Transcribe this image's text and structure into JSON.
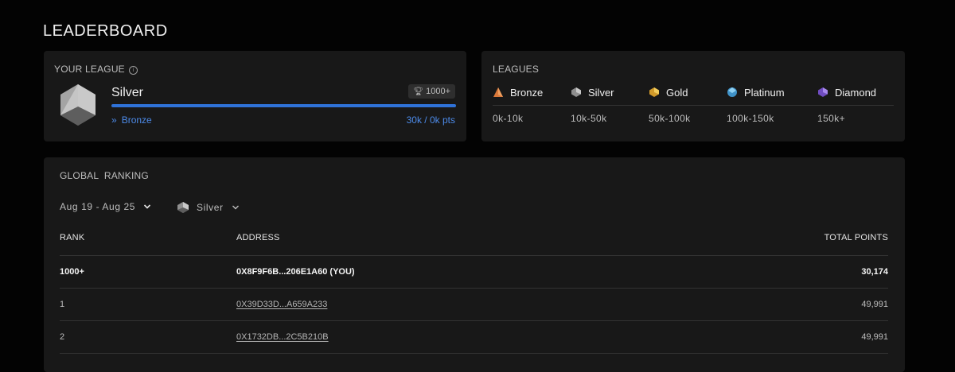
{
  "page": {
    "title": "LEADERBOARD"
  },
  "your_league": {
    "label": "YOUR LEAGUE",
    "name": "Silver",
    "rank": "1000+",
    "progress_fraction": 1.0,
    "next_league": "Bronze",
    "points": "30k / 0k pts",
    "accent_color": "#2f72d8"
  },
  "leagues": {
    "label": "LEAGUES",
    "items": [
      {
        "name": "Bronze",
        "range": "0k-10k",
        "icon": "bronze-league-icon",
        "color": "#d9783a"
      },
      {
        "name": "Silver",
        "range": "10k-50k",
        "icon": "silver-league-icon",
        "color": "#a8a8a8"
      },
      {
        "name": "Gold",
        "range": "50k-100k",
        "icon": "gold-league-icon",
        "color": "#e6b43c"
      },
      {
        "name": "Platinum",
        "range": "100k-150k",
        "icon": "platinum-league-icon",
        "color": "#5aaee0"
      },
      {
        "name": "Diamond",
        "range": "150k+",
        "icon": "diamond-league-icon",
        "color": "#8a63d8"
      }
    ]
  },
  "ranking": {
    "label": "GLOBAL  RANKING",
    "date_filter": "Aug 19 - Aug 25",
    "league_filter": "Silver",
    "columns": {
      "rank": "RANK",
      "address": "ADDRESS",
      "points": "TOTAL POINTS"
    },
    "rows": [
      {
        "rank": "1000+",
        "address": "0X8F9F6B...206E1A60 (YOU)",
        "points": "30,174",
        "is_you": true
      },
      {
        "rank": "1",
        "address": "0X39D33D...A659A233",
        "points": "49,991",
        "is_you": false
      },
      {
        "rank": "2",
        "address": "0X1732DB...2C5B210B",
        "points": "49,991",
        "is_you": false
      }
    ]
  }
}
